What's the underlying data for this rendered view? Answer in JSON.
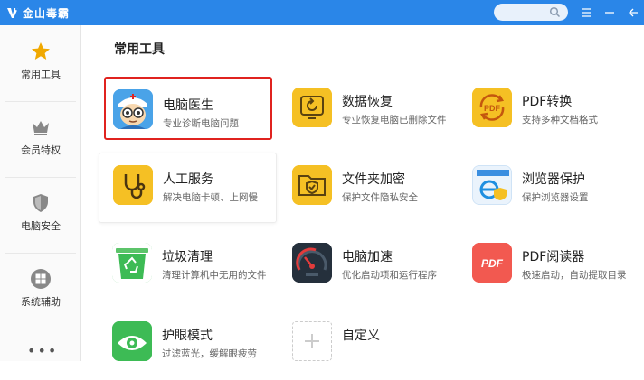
{
  "titlebar": {
    "brand": "金山毒霸",
    "search_placeholder": "",
    "buttons": [
      "search-icon",
      "menu-icon",
      "minimize-icon",
      "back-icon"
    ],
    "color": "#2a86e8"
  },
  "sidebar": {
    "items": [
      {
        "label": "常用工具",
        "icon": "star-icon",
        "active": true
      },
      {
        "label": "会员特权",
        "icon": "crown-icon"
      },
      {
        "label": "电脑安全",
        "icon": "shield-icon"
      },
      {
        "label": "系统辅助",
        "icon": "windows-logo-icon"
      }
    ],
    "more": "•••"
  },
  "main": {
    "section_title": "常用工具",
    "tools": [
      {
        "name": "电脑医生",
        "desc": "专业诊断电脑问题",
        "icon": "doctor-icon",
        "selected": true
      },
      {
        "name": "数据恢复",
        "desc": "专业恢复电脑已删除文件",
        "icon": "data-recovery-icon"
      },
      {
        "name": "PDF转换",
        "desc": "支持多种文档格式",
        "icon": "pdf-convert-icon"
      },
      {
        "name": "人工服务",
        "desc": "解决电脑卡顿、上网慢",
        "icon": "stethoscope-icon",
        "hovered": true
      },
      {
        "name": "文件夹加密",
        "desc": "保护文件隐私安全",
        "icon": "folder-lock-icon"
      },
      {
        "name": "浏览器保护",
        "desc": "保护浏览器设置",
        "icon": "browser-shield-icon"
      },
      {
        "name": "垃圾清理",
        "desc": "清理计算机中无用的文件",
        "icon": "recycle-bin-icon"
      },
      {
        "name": "电脑加速",
        "desc": "优化启动项和运行程序",
        "icon": "speedometer-icon"
      },
      {
        "name": "PDF阅读器",
        "desc": "极速启动，自动提取目录",
        "icon": "pdf-reader-icon"
      },
      {
        "name": "护眼模式",
        "desc": "过滤蓝光，缓解眼疲劳",
        "icon": "eye-icon"
      },
      {
        "name": "自定义",
        "desc": "",
        "icon": "plus-icon"
      }
    ],
    "pdf_badge": "PDF"
  },
  "colors": {
    "accent": "#2a86e8",
    "selected_border": "#e0231f",
    "yellow": "#f5c024",
    "star": "#f0a800",
    "pdf_red": "#f25950",
    "green": "#3dbb55"
  }
}
